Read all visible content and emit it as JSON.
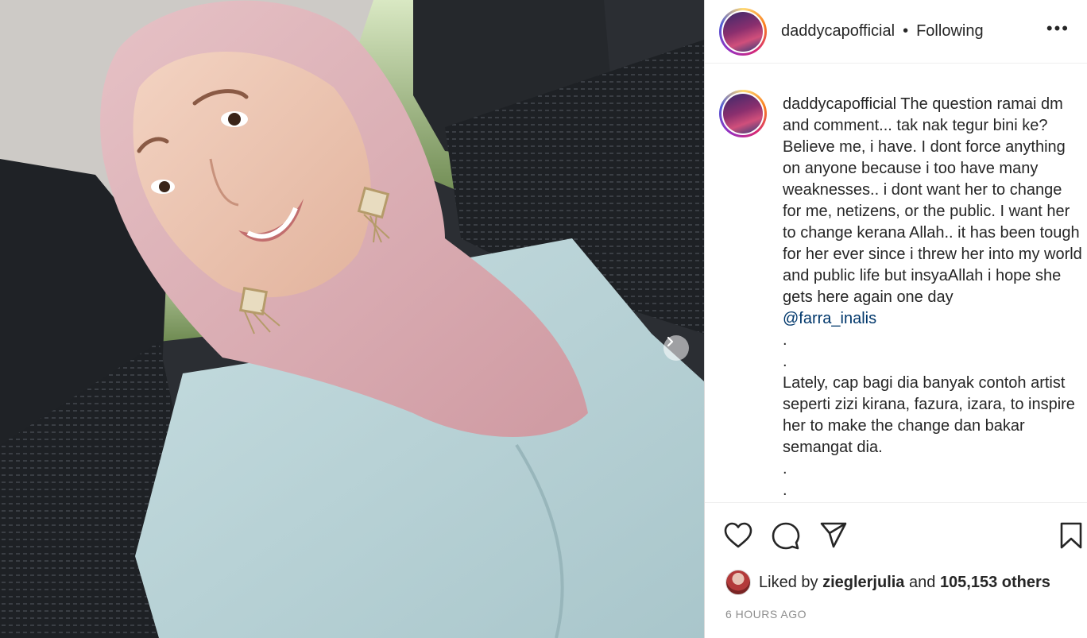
{
  "header": {
    "username": "daddycapofficial",
    "separator": "•",
    "follow_status": "Following",
    "more_label": "•••"
  },
  "caption": {
    "username": "daddycapofficial",
    "text_part1": "The question ramai dm and comment... tak nak tegur bini ke? Believe me, i have. I dont force anything on anyone because i too have many weaknesses.. i dont want her to change for me, netizens, or the public. I want her to change kerana Allah.. it has been tough for her ever since i threw her into my world and public life but insyaAllah i hope she gets here again one day",
    "mention": "@farra_inalis",
    "dot1": ".",
    "dot2": ".",
    "text_part2": "Lately, cap bagi dia banyak contoh artist seperti zizi kirana, fazura, izara, to inspire her to make the change dan bakar semangat dia.",
    "dot3": ".",
    "dot4": "."
  },
  "likes": {
    "prefix": "Liked by",
    "liker": "zieglerjulia",
    "conjunction": "and",
    "others": "105,153 others"
  },
  "timestamp": "6 HOURS AGO",
  "icons": {
    "like": "heart-icon",
    "comment": "comment-icon",
    "share": "send-icon",
    "save": "bookmark-icon",
    "next": "chevron-right-icon"
  }
}
